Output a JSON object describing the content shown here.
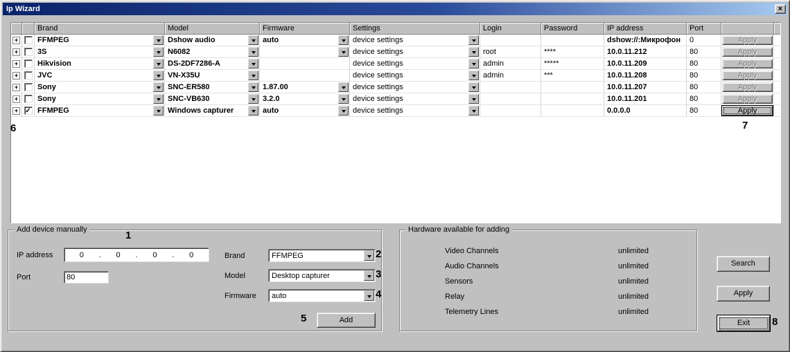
{
  "window": {
    "title": "Ip Wizard"
  },
  "icons": {
    "close": "×",
    "check": "✓",
    "expand": "+"
  },
  "table": {
    "headers": {
      "brand": "Brand",
      "model": "Model",
      "firmware": "Firmware",
      "settings": "Settings",
      "login": "Login",
      "password": "Password",
      "ip": "IP address",
      "port": "Port"
    },
    "apply_label": "Apply",
    "rows": [
      {
        "checked": false,
        "brand": "FFMPEG",
        "model": "Dshow audio",
        "firmware": "auto",
        "firmware_arrow": true,
        "settings": "device settings",
        "login": "",
        "password": "",
        "ip": "dshow://:Микрофон",
        "port": "0",
        "apply_enabled": false
      },
      {
        "checked": false,
        "brand": "3S",
        "model": "N6082",
        "firmware": "",
        "firmware_arrow": true,
        "settings": "device settings",
        "login": "root",
        "password": "****",
        "ip": "10.0.11.212",
        "port": "80",
        "apply_enabled": false
      },
      {
        "checked": false,
        "brand": "Hikvision",
        "model": "DS-2DF7286-A",
        "firmware": "",
        "firmware_arrow": false,
        "settings": "device settings",
        "login": "admin",
        "password": "*****",
        "ip": "10.0.11.209",
        "port": "80",
        "apply_enabled": false
      },
      {
        "checked": false,
        "brand": "JVC",
        "model": "VN-X35U",
        "firmware": "",
        "firmware_arrow": false,
        "settings": "device settings",
        "login": "admin",
        "password": "***",
        "ip": "10.0.11.208",
        "port": "80",
        "apply_enabled": false
      },
      {
        "checked": false,
        "brand": "Sony",
        "model": "SNC-ER580",
        "firmware": "1.87.00",
        "firmware_arrow": true,
        "settings": "device settings",
        "login": "",
        "password": "",
        "ip": "10.0.11.207",
        "port": "80",
        "apply_enabled": false
      },
      {
        "checked": false,
        "brand": "Sony",
        "model": "SNC-VB630",
        "firmware": "3.2.0",
        "firmware_arrow": true,
        "settings": "device settings",
        "login": "",
        "password": "",
        "ip": "10.0.11.201",
        "port": "80",
        "apply_enabled": false
      },
      {
        "checked": true,
        "brand": "FFMPEG",
        "model": "Windows capturer",
        "firmware": "auto",
        "firmware_arrow": true,
        "settings": "device settings",
        "login": "",
        "password": "",
        "ip": "0.0.0.0",
        "port": "80",
        "apply_enabled": true
      }
    ]
  },
  "add_device": {
    "title": "Add device manually",
    "ip_label": "IP address",
    "ip_parts": [
      "0",
      "0",
      "0",
      "0"
    ],
    "ip_separator": ".",
    "port_label": "Port",
    "port_value": "80",
    "brand_label": "Brand",
    "brand_value": "FFMPEG",
    "model_label": "Model",
    "model_value": "Desktop capturer",
    "firmware_label": "Firmware",
    "firmware_value": "auto",
    "add_button": "Add"
  },
  "hardware": {
    "title": "Hardware available for adding",
    "rows": [
      {
        "label": "Video Channels",
        "value": "unlimited"
      },
      {
        "label": "Audio Channels",
        "value": "unlimited"
      },
      {
        "label": "Sensors",
        "value": "unlimited"
      },
      {
        "label": "Relay",
        "value": "unlimited"
      },
      {
        "label": "Telemetry Lines",
        "value": "unlimited"
      }
    ]
  },
  "actions": {
    "search": "Search",
    "apply": "Apply",
    "exit": "Exit"
  },
  "callouts": {
    "c1": "1",
    "c2": "2",
    "c3": "3",
    "c4": "4",
    "c5": "5",
    "c6": "6",
    "c7": "7",
    "c8": "8"
  }
}
